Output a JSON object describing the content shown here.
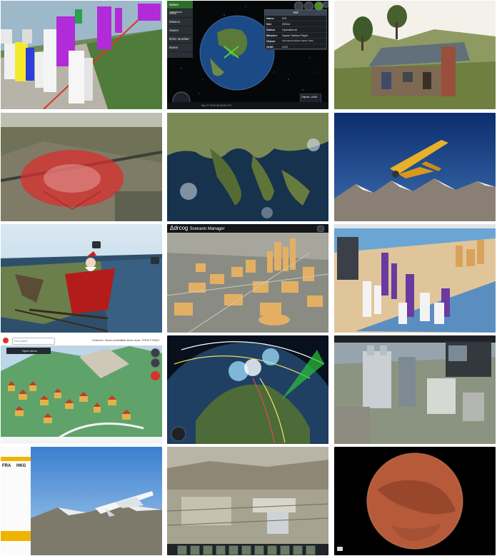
{
  "gallery": {
    "tiles": [
      {
        "id": "city-3d-buildings"
      },
      {
        "id": "iss-satellite-tracker",
        "sidebar": [
          "Status",
          "Orbit",
          "Mission",
          "Owner",
          "IDSC Number",
          "Name"
        ],
        "status_value": "Operational",
        "info_title": "ISS",
        "info_rows": [
          {
            "key": "Name",
            "value": "ISS"
          },
          {
            "key": "NAI",
            "value": "25544"
          },
          {
            "key": "Status",
            "value": "Operational"
          },
          {
            "key": "Mission",
            "value": "Space Station Flight"
          },
          {
            "key": "Owner",
            "value": "International Space Station (ISS)"
          },
          {
            "key": "Orbit",
            "value": "LEO"
          }
        ],
        "status_box": "Objects: 14935",
        "footer": "Sep 07 2015 08:28:48 UTC"
      },
      {
        "id": "farmhouse-terrain"
      },
      {
        "id": "volume-dome-terrain"
      },
      {
        "id": "southeast-asia-satellite"
      },
      {
        "id": "airplane-mountains"
      },
      {
        "id": "santa-sleigh-tracker"
      },
      {
        "id": "scenario-manager-city",
        "header_title": "Scenario Manager"
      },
      {
        "id": "nyc-3d-buildings"
      },
      {
        "id": "alpine-village-map",
        "search_placeholder": "Find place",
        "menu_label": "Open menu",
        "top_links": [
          "Fullscreen",
          "Report problem",
          "Help",
          "About venue",
          "PROE P RADO"
        ]
      },
      {
        "id": "global-orbit-visualization"
      },
      {
        "id": "city-photo-mesh"
      },
      {
        "id": "flight-tracker",
        "from": "FRA",
        "to": "HKG"
      },
      {
        "id": "desert-aerial-terrain"
      },
      {
        "id": "mars-globe"
      }
    ]
  }
}
